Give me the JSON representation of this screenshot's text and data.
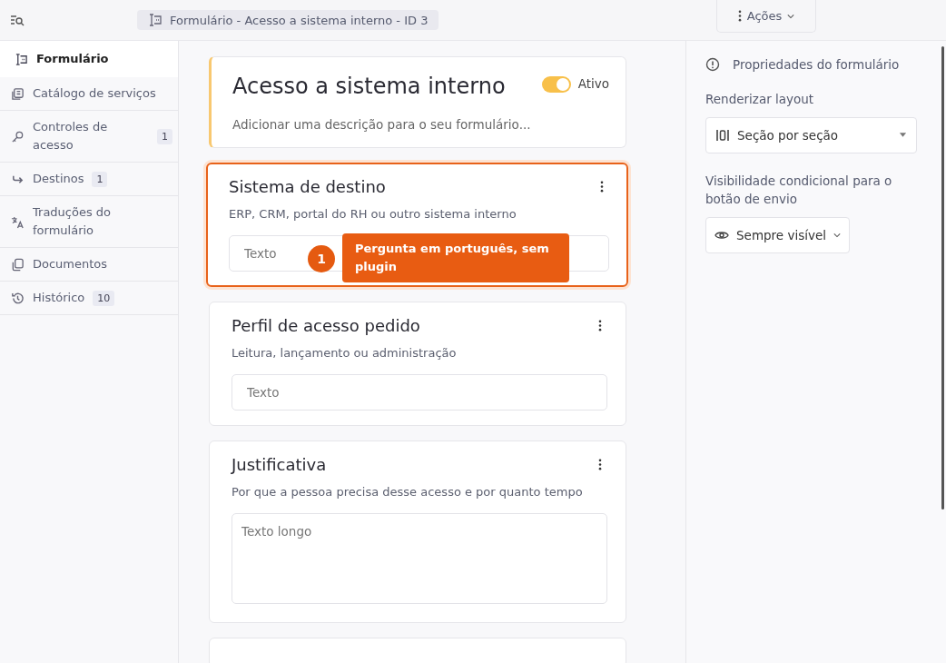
{
  "header": {
    "breadcrumb": "Formulário -  Acesso a sistema interno - ID 3",
    "actions_button": "Ações"
  },
  "sidebar": {
    "items": [
      {
        "label": "Formulário",
        "selected": true
      },
      {
        "label": "Catálogo de serviços",
        "selected": false
      },
      {
        "label": "Controles de acesso",
        "badge": "1",
        "selected": false
      },
      {
        "label": "Destinos",
        "badge": "1",
        "selected": false
      },
      {
        "label": "Traduções do formulário",
        "selected": false
      },
      {
        "label": "Documentos",
        "selected": false
      },
      {
        "label": "Histórico",
        "badge": "10",
        "selected": false
      }
    ]
  },
  "form": {
    "title": "Acesso a sistema interno",
    "active": true,
    "active_label": "Ativo",
    "description_placeholder": "Adicionar uma descrição para o seu formulário..."
  },
  "questions": [
    {
      "title": "Sistema de destino",
      "description": "ERP, CRM, portal do RH ou outro sistema interno",
      "kind": "text",
      "placeholder": "Texto",
      "selected": true
    },
    {
      "title": "Perfil de acesso pedido",
      "description": "Leitura, lançamento ou administração",
      "kind": "text",
      "placeholder": "Texto",
      "selected": false
    },
    {
      "title": "Justificativa",
      "description": "Por que a pessoa precisa desse acesso e por quanto tempo",
      "kind": "textarea",
      "placeholder": "Texto longo",
      "selected": false
    }
  ],
  "annotation": {
    "number": "1",
    "text": "Pergunta em português, sem plugin"
  },
  "properties": {
    "title": "Propriedades do formulário",
    "layout_label": "Renderizar layout",
    "layout_value": "Seção por seção",
    "visibility_label": "Visibilidade condicional para o botão de envio",
    "visibility_value": "Sempre visível"
  }
}
